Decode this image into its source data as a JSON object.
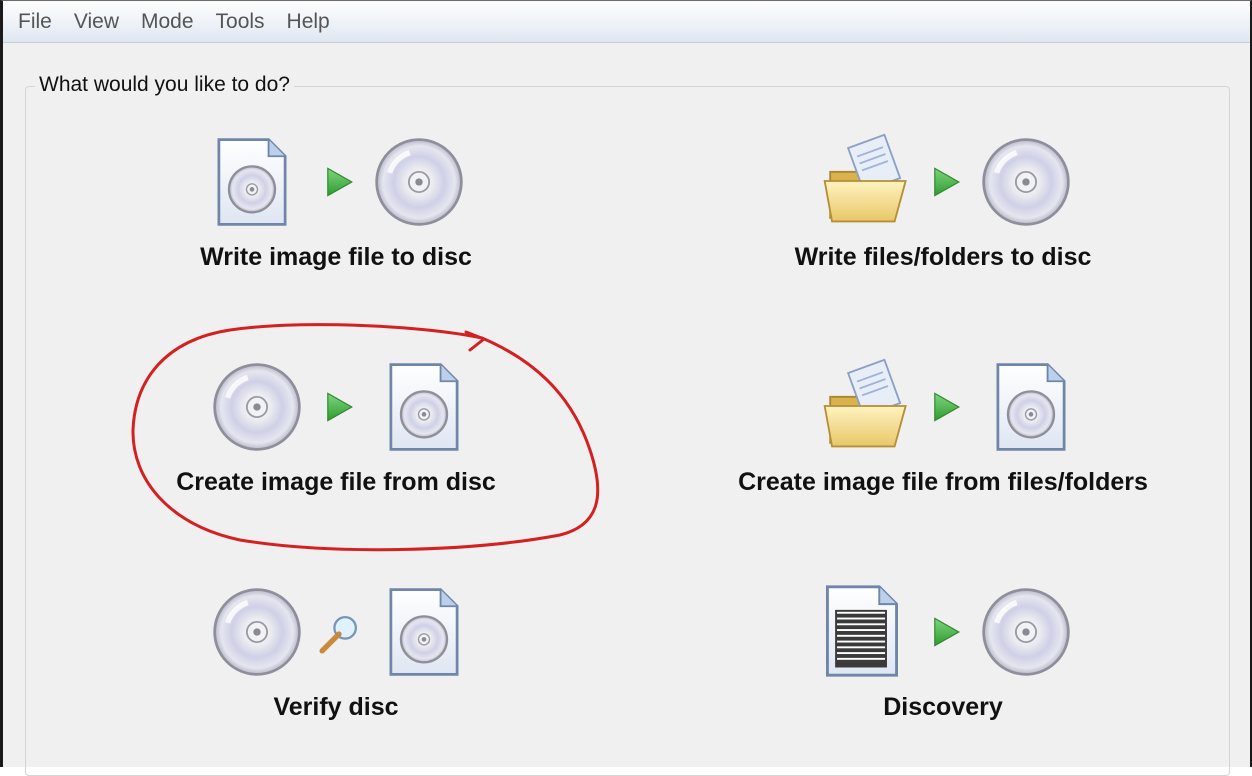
{
  "menu": {
    "file": "File",
    "view": "View",
    "mode": "Mode",
    "tools": "Tools",
    "help": "Help"
  },
  "group_title": "What would you like to do?",
  "tasks": [
    {
      "label": "Write image file to disc"
    },
    {
      "label": "Write files/folders to disc"
    },
    {
      "label": "Create image file from disc"
    },
    {
      "label": "Create image file from files/folders"
    },
    {
      "label": "Verify disc"
    },
    {
      "label": "Discovery"
    }
  ],
  "colors": {
    "annotation": "#d42020",
    "arrow": "#3fae3f"
  }
}
